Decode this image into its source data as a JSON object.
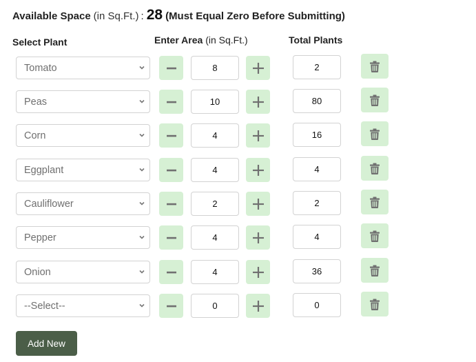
{
  "summary": {
    "label": "Available Space",
    "unit": "(in Sq.Ft.)",
    "colon": ":",
    "value": "28",
    "note": "(Must Equal Zero Before Submitting)"
  },
  "headers": {
    "plant": "Select Plant",
    "area": "Enter Area",
    "area_unit": "(in Sq.Ft.)",
    "total": "Total Plants"
  },
  "icons": {
    "minus": "minus-icon",
    "plus": "plus-icon",
    "delete": "trash-icon",
    "dropdown": "chevron-down-icon"
  },
  "colors": {
    "step_button_bg": "#d6f0d4",
    "icon_gray": "#707070",
    "primary_button_bg": "#4b5e48"
  },
  "rows": [
    {
      "plant": "Tomato",
      "area": "8",
      "total": "2"
    },
    {
      "plant": "Peas",
      "area": "10",
      "total": "80"
    },
    {
      "plant": "Corn",
      "area": "4",
      "total": "16"
    },
    {
      "plant": "Eggplant",
      "area": "4",
      "total": "4"
    },
    {
      "plant": "Cauliflower",
      "area": "2",
      "total": "2"
    },
    {
      "plant": "Pepper",
      "area": "4",
      "total": "4"
    },
    {
      "plant": "Onion",
      "area": "4",
      "total": "36"
    },
    {
      "plant": "--Select--",
      "area": "0",
      "total": "0"
    }
  ],
  "add_button": "Add New"
}
